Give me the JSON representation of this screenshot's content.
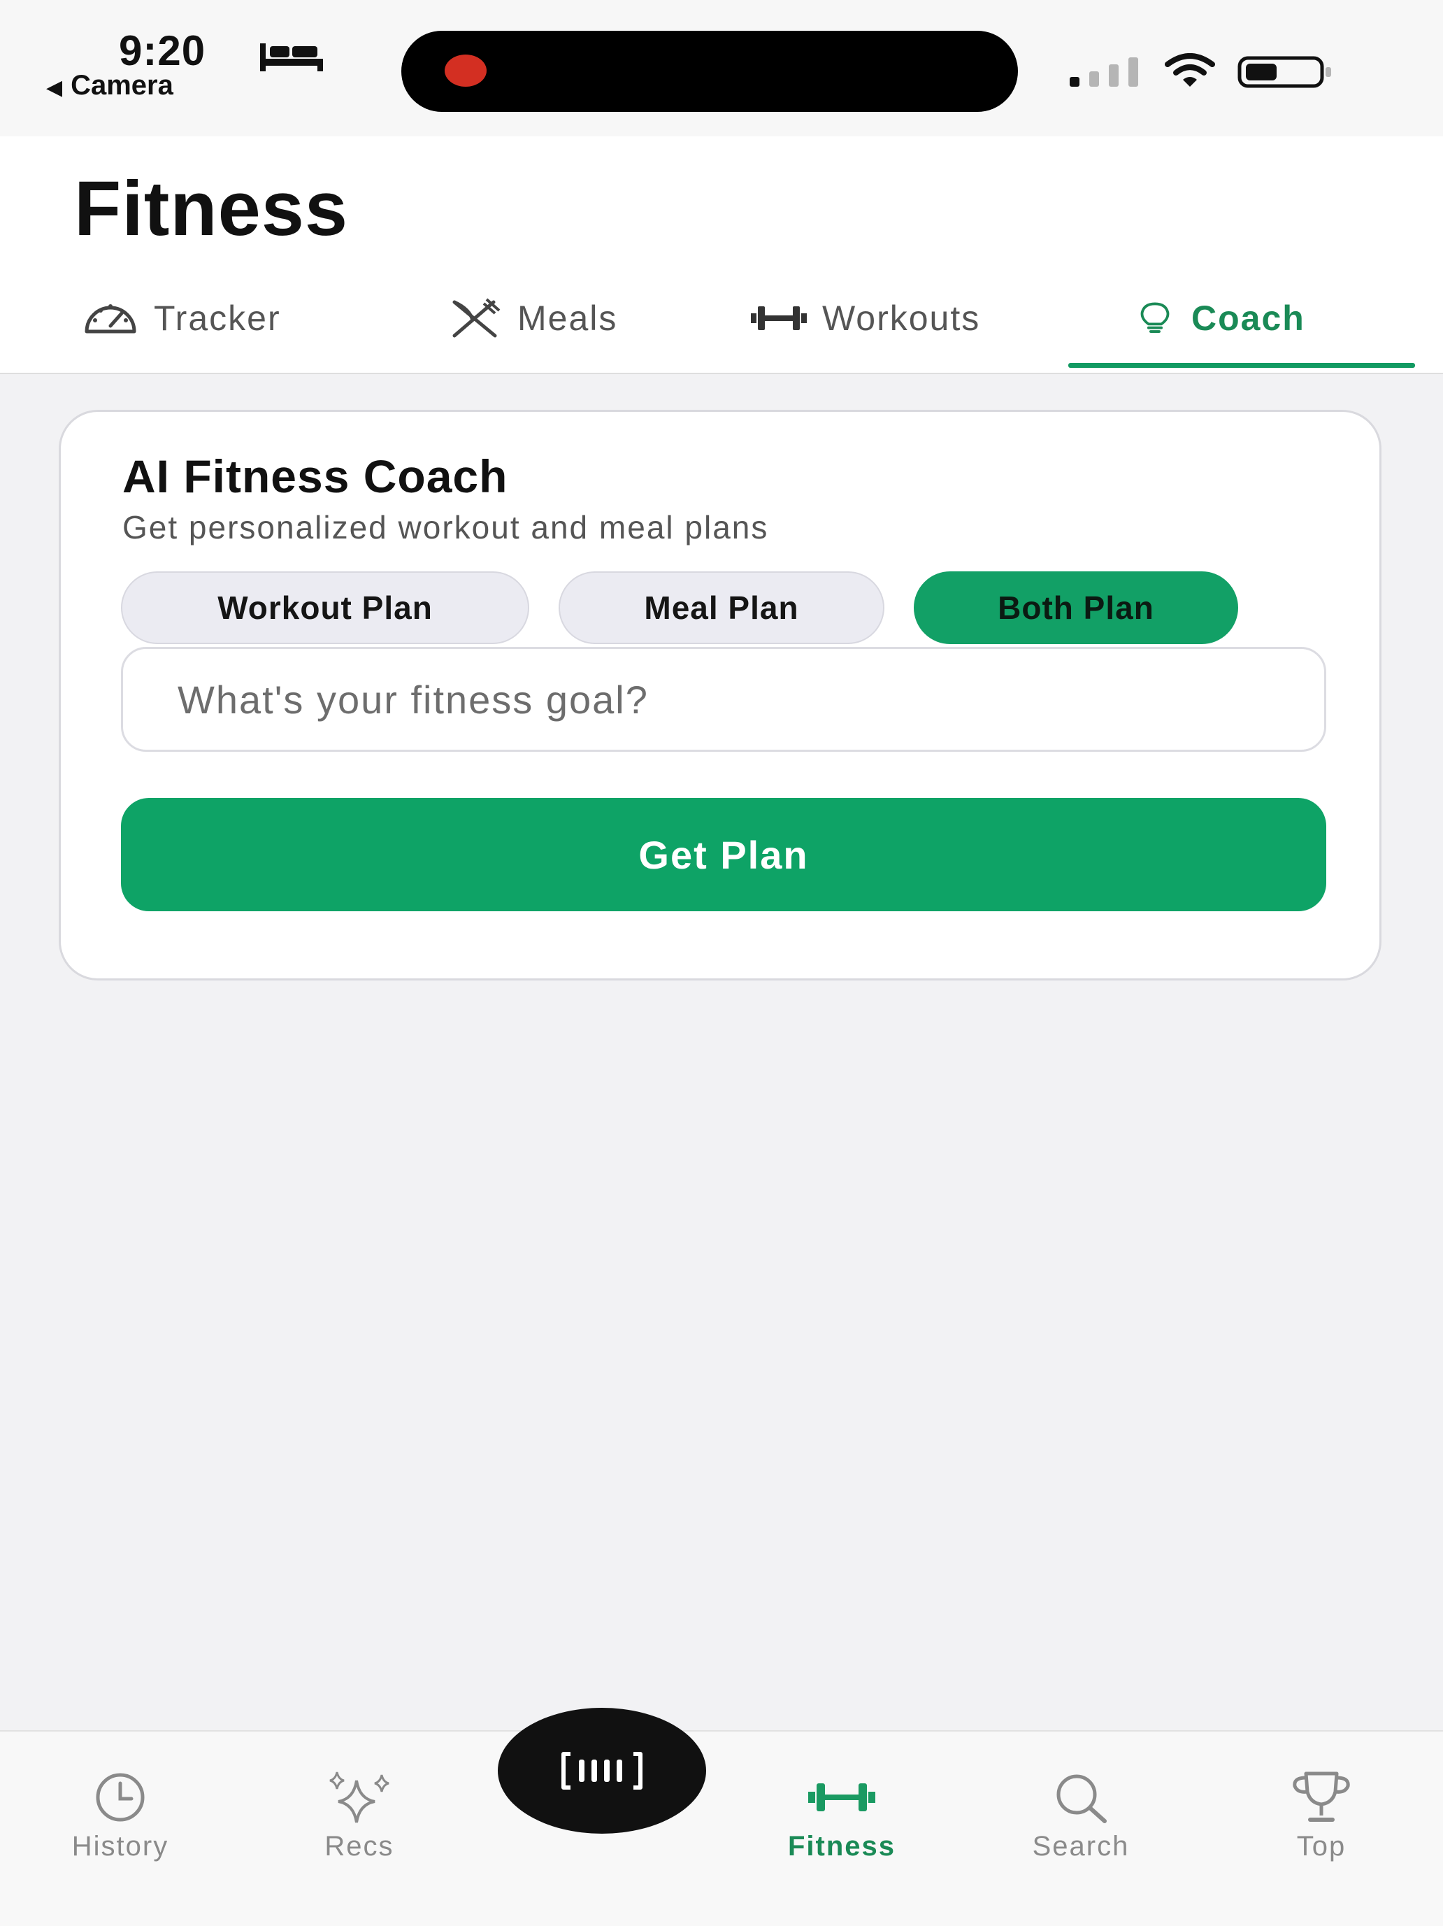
{
  "status_bar": {
    "time": "9:20",
    "back_label": "Camera",
    "back_arrow": "◀"
  },
  "header": {
    "title": "Fitness",
    "tabs": [
      {
        "label": "Tracker",
        "icon": "speedometer-icon",
        "active": false
      },
      {
        "label": "Meals",
        "icon": "fork-knife-icon",
        "active": false
      },
      {
        "label": "Workouts",
        "icon": "dumbbell-icon",
        "active": false
      },
      {
        "label": "Coach",
        "icon": "lightbulb-icon",
        "active": true
      }
    ]
  },
  "coach_card": {
    "title": "AI Fitness Coach",
    "subtitle": "Get personalized workout and meal plans",
    "plan_options": [
      {
        "label": "Workout Plan",
        "selected": false
      },
      {
        "label": "Meal Plan",
        "selected": false
      },
      {
        "label": "Both Plan",
        "selected": true
      }
    ],
    "goal_input": {
      "value": "",
      "placeholder": "What's your fitness goal?"
    },
    "submit_label": "Get Plan"
  },
  "bottom_nav": {
    "items": [
      {
        "label": "History",
        "icon": "clock-icon",
        "active": false
      },
      {
        "label": "Recs",
        "icon": "sparkles-icon",
        "active": false
      },
      {
        "label": "Fitness",
        "icon": "dumbbell-icon",
        "active": true
      },
      {
        "label": "Search",
        "icon": "search-icon",
        "active": false
      },
      {
        "label": "Top",
        "icon": "trophy-icon",
        "active": false
      }
    ],
    "center_button_icon": "barcode-scan-icon"
  },
  "colors": {
    "accent": "#12a066",
    "accent_text": "#1a8a56",
    "background": "#f2f2f4",
    "card": "#ffffff",
    "chip_inactive": "#ebebf2",
    "recording_dot": "#d32f22"
  }
}
